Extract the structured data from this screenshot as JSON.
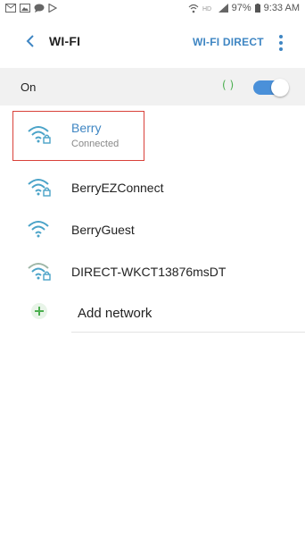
{
  "status_bar": {
    "battery": "97%",
    "time": "9:33 AM",
    "left_icons": [
      "mail-icon",
      "image-icon",
      "chat-icon",
      "play-store-icon"
    ],
    "right_icons": [
      "wifi-call-icon",
      "hd-voice-icon",
      "signal-icon",
      "battery-icon"
    ]
  },
  "header": {
    "title": "WI-FI",
    "wifi_direct_label": "WI-FI DIRECT"
  },
  "toggle": {
    "label": "On",
    "scan_indicator": "( )",
    "state": "on"
  },
  "networks": [
    {
      "name": "Berry",
      "status": "Connected",
      "secured": true,
      "icon": "wifi-secured-icon"
    },
    {
      "name": "BerryEZConnect",
      "status": "",
      "secured": true,
      "icon": "wifi-secured-icon"
    },
    {
      "name": "BerryGuest",
      "status": "",
      "secured": false,
      "icon": "wifi-icon"
    },
    {
      "name": "DIRECT-WKCT13876msDT",
      "status": "",
      "secured": true,
      "icon": "wifi-secured-icon"
    }
  ],
  "add_network": {
    "label": "Add network",
    "icon": "plus-icon"
  },
  "colors": {
    "accent": "#3f86c3",
    "toggle_on": "#4a90d9",
    "wifi_icon": "#4aa3c8",
    "add_icon": "#4caf50",
    "highlight": "#d9413a",
    "toggle_row_bg": "#f1f1f1"
  }
}
